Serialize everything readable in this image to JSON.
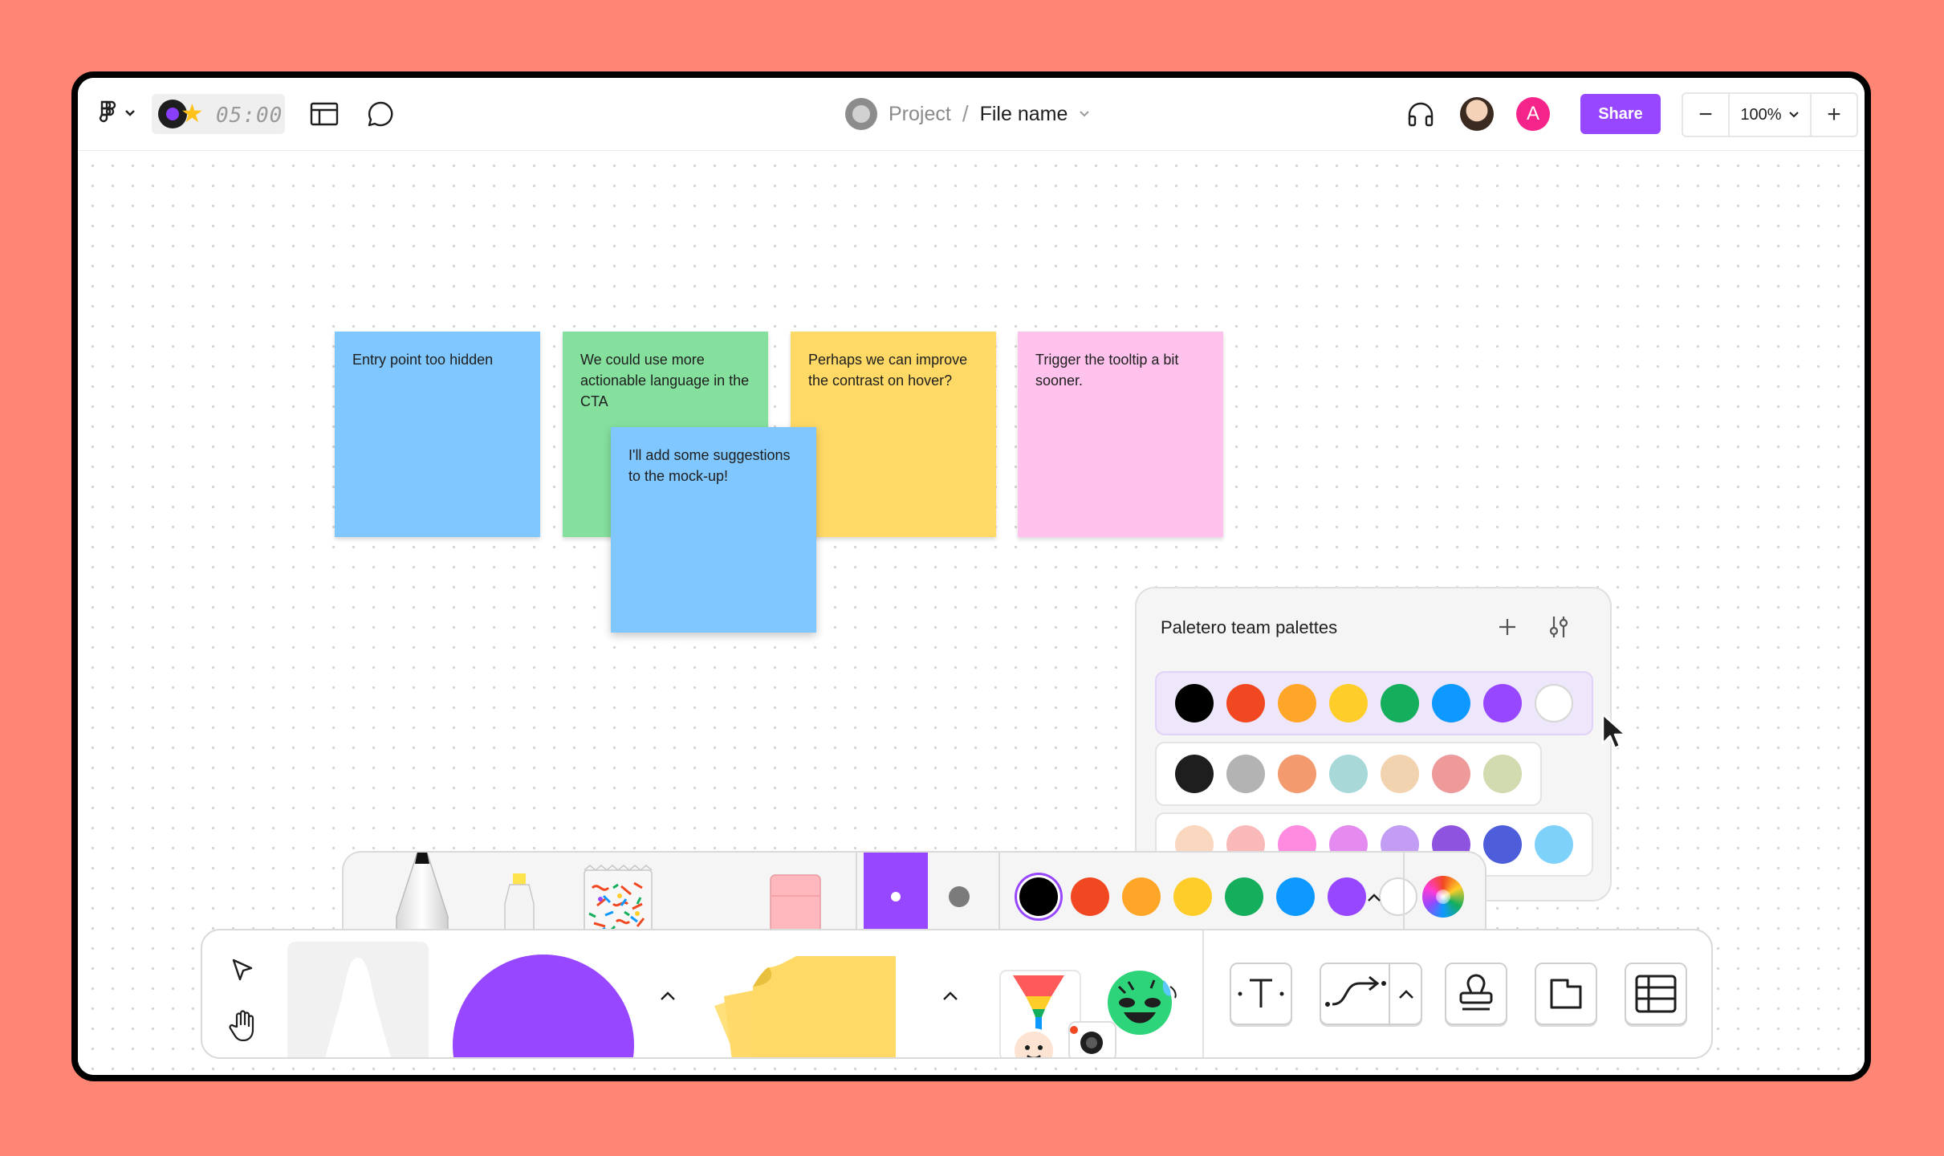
{
  "topbar": {
    "timer": "05:00",
    "breadcrumb": {
      "project": "Project",
      "separator": "/",
      "file": "File name"
    },
    "avatar_letter": "A",
    "share_label": "Share",
    "zoom": {
      "minus": "−",
      "value": "100%",
      "plus": "+"
    }
  },
  "stickies": [
    {
      "text": "Entry point too hidden",
      "color": "#80C7FF"
    },
    {
      "text": "We could use more actionable language in the CTA",
      "color": "#85E09E"
    },
    {
      "text": "Perhaps we can improve the contrast on hover?",
      "color": "#FFD966"
    },
    {
      "text": "Trigger the tooltip a bit sooner.",
      "color": "#FFC2EC"
    },
    {
      "text": "I'll add some suggestions to the mock-up!",
      "color": "#80C7FF"
    }
  ],
  "palette_panel": {
    "title": "Paletero team palettes",
    "rows": [
      [
        "#000000",
        "#F24822",
        "#FFA629",
        "#FFCD29",
        "#14AE5C",
        "#0D99FF",
        "#9747FF",
        "#FFFFFF"
      ],
      [
        "#1E1E1E",
        "#B3B3B3",
        "#F39A6E",
        "#A8D8D8",
        "#F1D3B0",
        "#EF9A9A",
        "#D2DAB0"
      ],
      [
        "#FAD8BF",
        "#F9B9B9",
        "#FF8BE0",
        "#E58BF0",
        "#C29DF3",
        "#8E54E0",
        "#4E5EDB",
        "#7ED2FA"
      ]
    ]
  },
  "brush_toolbar": {
    "active_color": "#9747FF",
    "colors": [
      "#000000",
      "#F24822",
      "#FFA629",
      "#FFCD29",
      "#14AE5C",
      "#0D99FF",
      "#9747FF",
      "#FFFFFF"
    ]
  },
  "tools": {
    "shape_color": "#9747FF",
    "sticky_color": "#FFD966"
  }
}
